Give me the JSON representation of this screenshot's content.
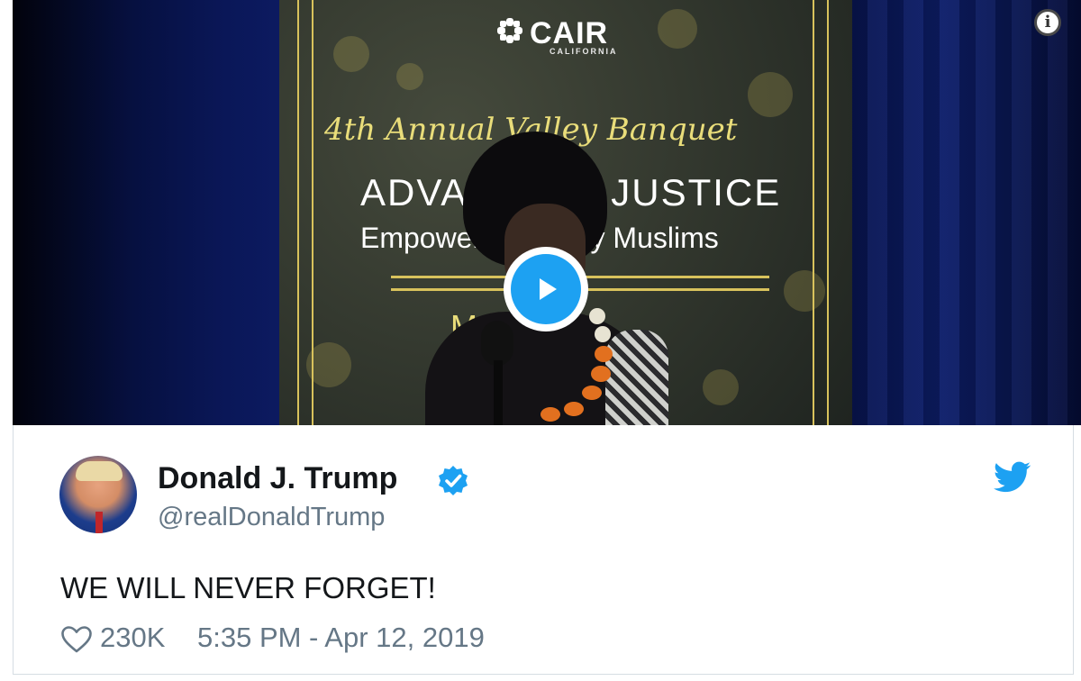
{
  "video": {
    "sign": {
      "org_name": "CAIR",
      "org_sub": "CALIFORNIA",
      "event_line": "4th Annual Valley Banquet",
      "headline": "ADVANCING JUSTICE",
      "subline": "Empowering Valley Muslims",
      "date": "May 2019"
    },
    "play_icon": "play-icon",
    "info_icon": "info-icon",
    "colors": {
      "play_accent": "#1da1f2",
      "gold": "#d8c25c"
    }
  },
  "tweet": {
    "author_name": "Donald J. Trump",
    "author_handle": "@realDonaldTrump",
    "verified_icon": "verified-badge-icon",
    "brand_icon": "twitter-bird-icon",
    "text": "WE WILL NEVER FORGET!",
    "likes": "230K",
    "timestamp": "5:35 PM - Apr 12, 2019",
    "colors": {
      "brand": "#1da1f2",
      "secondary_text": "#657786",
      "primary_text": "#14171a"
    }
  }
}
